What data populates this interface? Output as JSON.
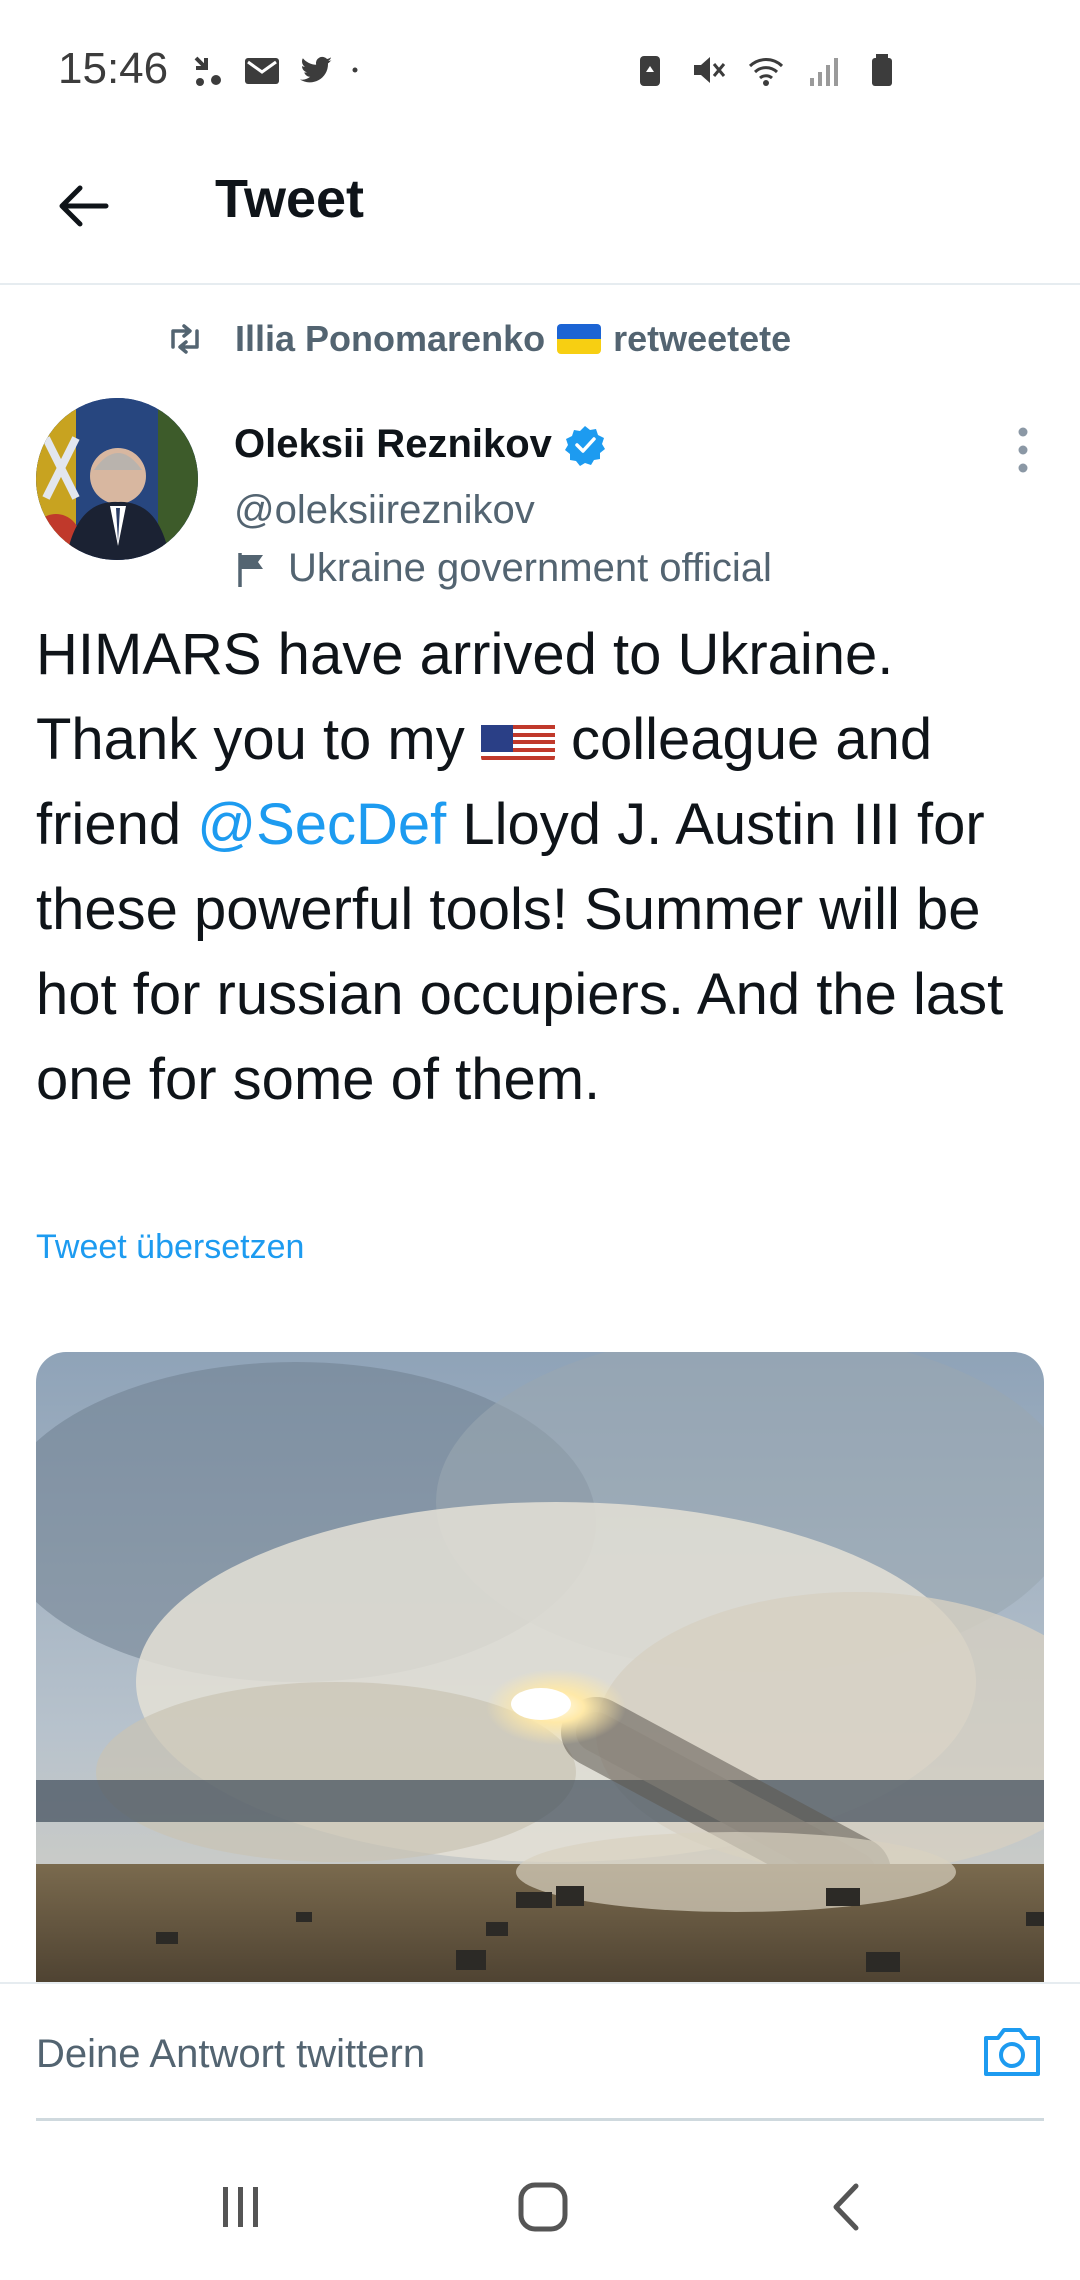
{
  "status_bar": {
    "time": "15:46",
    "left_icons": [
      "missed-call-icon",
      "mail-icon",
      "twitter-bird-icon",
      "dot-icon"
    ],
    "right_icons": [
      "battery-saver-icon",
      "mute-icon",
      "wifi-icon",
      "signal-icon",
      "battery-icon"
    ]
  },
  "header": {
    "title": "Tweet",
    "back_icon": "arrow-left-icon"
  },
  "retweet": {
    "retweeter": "Illia Ponomarenko",
    "action": "retweetete",
    "flag": "ukraine-flag-emoji"
  },
  "author": {
    "name": "Oleksii Reznikov",
    "handle": "@oleksiireznikov",
    "label": "Ukraine government official",
    "verified": true
  },
  "tweet": {
    "text_1": "HIMARS have arrived to Ukraine. Thank you to my ",
    "flag": "us-flag-emoji",
    "text_2": " colleague and friend ",
    "mention": "@SecDef",
    "text_3": " Lloyd J. Austin III for these powerful tools! Summer will be hot for russian occupiers. And the last one for some of them.",
    "translate": "Tweet übersetzen"
  },
  "media": {
    "description_icon": "rocket-launch-photo"
  },
  "reply": {
    "placeholder": "Deine Antwort twittern"
  },
  "colors": {
    "accent": "#1d9bf0",
    "text_primary": "#0f1419",
    "text_secondary": "#536471",
    "divider": "#e6ecf0"
  }
}
